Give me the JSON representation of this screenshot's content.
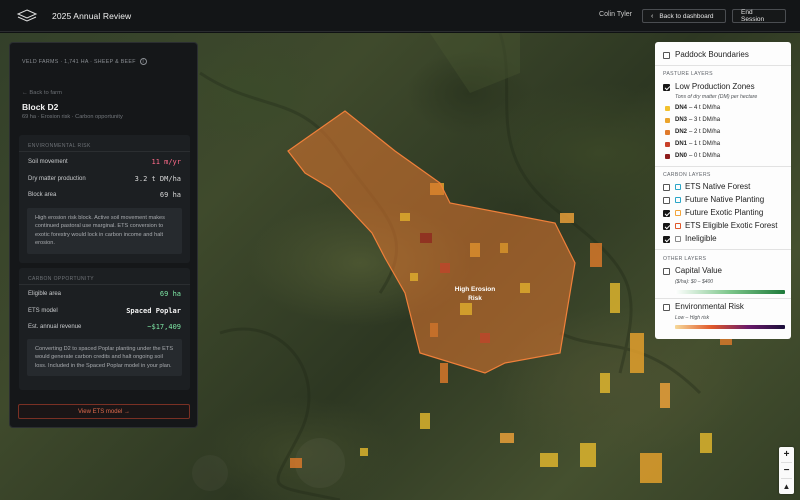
{
  "header": {
    "title": "2025 Annual Review",
    "user": "Colin Tyler",
    "back_button": "Back to dashboard",
    "end_button": "End Session"
  },
  "panel": {
    "farm_meta": "VELD FARMS · 1,741 HA · SHEEP & BEEF",
    "back_link": "← Back to farm",
    "block_title": "Block D2",
    "block_sub": "69 ha · Erosion risk · Carbon opportunity",
    "env": {
      "heading": "ENVIRONMENTAL RISK",
      "rows": [
        {
          "label": "Soil movement",
          "value": "11 m/yr"
        },
        {
          "label": "Dry matter production",
          "value": "3.2 t DM/ha"
        },
        {
          "label": "Block area",
          "value": "69 ha"
        }
      ],
      "note": "High erosion risk block. Active soil movement makes continued pastoral use marginal. ETS conversion to exotic forestry would lock in carbon income and halt erosion."
    },
    "carbon": {
      "heading": "CARBON OPPORTUNITY",
      "rows": [
        {
          "label": "Eligible area",
          "value": "69 ha"
        },
        {
          "label": "ETS model",
          "value": "Spaced Poplar"
        },
        {
          "label": "Est. annual revenue",
          "value": "~$17,409"
        }
      ],
      "note": "Converting D2 to spaced Poplar planting under the ETS would generate carbon credits and halt ongoing soil loss. Included in the Spaced Poplar model in your plan."
    },
    "view_button": "View ETS model →"
  },
  "map": {
    "zone_label_1": "High Erosion",
    "zone_label_2": "Risk",
    "zoom_in": "+",
    "zoom_out": "−",
    "north": "▲"
  },
  "legend": {
    "paddock": "Paddock Boundaries",
    "pasture_heading": "PASTURE LAYERS",
    "low_prod": "Low Production Zones",
    "low_prod_sub": "Tons of dry matter (DM) per hectare",
    "dn": [
      {
        "code": "DN4",
        "text": "– 4 t DM/ha",
        "color": "#f2c12e"
      },
      {
        "code": "DN3",
        "text": "– 3 t DM/ha",
        "color": "#eba42c"
      },
      {
        "code": "DN2",
        "text": "– 2 t DM/ha",
        "color": "#e07a2b"
      },
      {
        "code": "DN1",
        "text": "– 1 t DM/ha",
        "color": "#c9402a"
      },
      {
        "code": "DN0",
        "text": "– 0 t DM/ha",
        "color": "#8e1d1d"
      }
    ],
    "carbon_heading": "CARBON LAYERS",
    "carbon_layers": [
      {
        "label": "ETS Native Forest",
        "checked": false,
        "color": "#2aa6c8"
      },
      {
        "label": "Future Native Planting",
        "checked": false,
        "color": "#2aa6c8"
      },
      {
        "label": "Future Exotic Planting",
        "checked": true,
        "color": "#f2a43a"
      },
      {
        "label": "ETS Eligible Exotic Forest",
        "checked": true,
        "color": "#e0582a"
      },
      {
        "label": "Ineligible",
        "checked": true,
        "color": "#8a8a8a"
      }
    ],
    "other_heading": "OTHER LAYERS",
    "capital": "Capital Value",
    "capital_range": "($/ha): $0 – $400",
    "env_risk": "Environmental Risk",
    "env_range": "Low – High risk"
  },
  "colors": {
    "accent_orange": "#e06a4c",
    "risk_red": "#ff6b8a",
    "revenue_green": "#7ee8a5"
  }
}
